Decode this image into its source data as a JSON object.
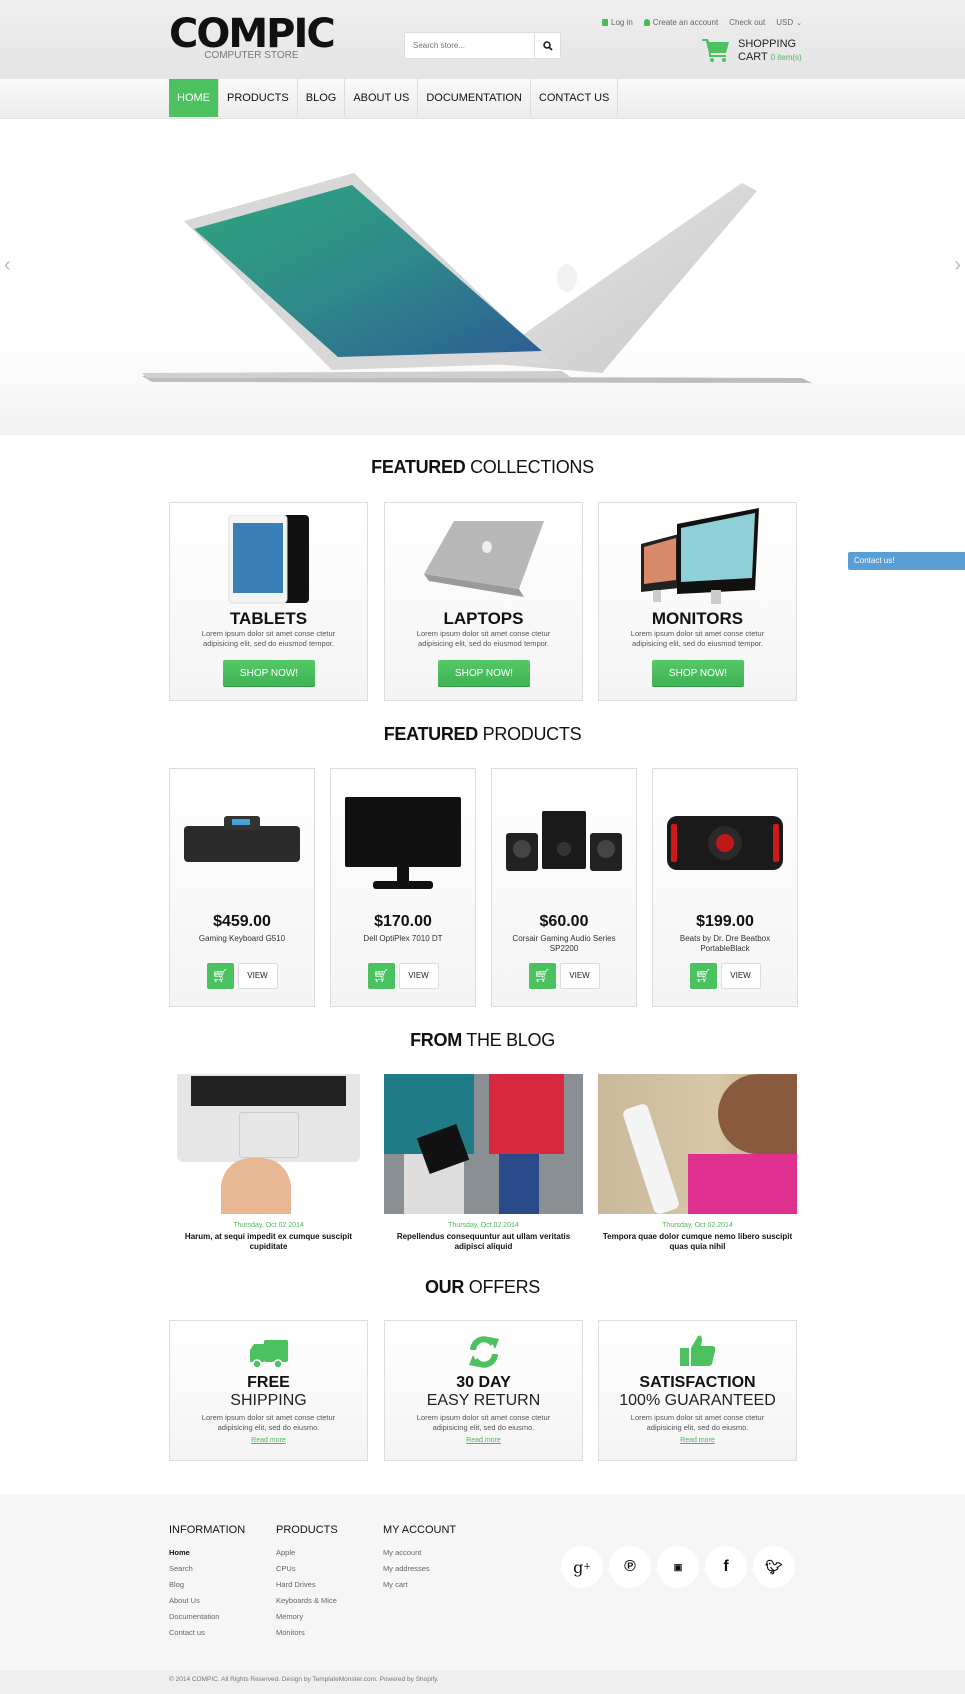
{
  "header": {
    "logo_name": "COMPIC",
    "logo_sub": "COMPUTER STORE",
    "search_placeholder": "Search store...",
    "links": {
      "login": "Log in",
      "create": "Create an account",
      "checkout": "Check out",
      "currency": "USD"
    },
    "cart": {
      "line1": "SHOPPING",
      "line2": "CART",
      "count": "0 item(s)"
    }
  },
  "nav": [
    "HOME",
    "PRODUCTS",
    "BLOG",
    "ABOUT US",
    "DOCUMENTATION",
    "CONTACT US"
  ],
  "hero": {
    "prev": "‹",
    "next": "›"
  },
  "contact_tab": "Contact us!",
  "collections": {
    "title_bold": "FEATURED",
    "title_light": "COLLECTIONS",
    "items": [
      {
        "title": "TABLETS",
        "desc1": "Lorem ipsum dolor sit amet conse ctetur",
        "desc2": "adipisicing elit, sed do eiusmod tempor.",
        "button": "SHOP NOW!"
      },
      {
        "title": "LAPTOPS",
        "desc1": "Lorem ipsum dolor sit amet conse ctetur",
        "desc2": "adipisicing elit, sed do eiusmod tempor.",
        "button": "SHOP NOW!"
      },
      {
        "title": "MONITORS",
        "desc1": "Lorem ipsum dolor sit amet conse ctetur",
        "desc2": "adipisicing elit, sed do eiusmod tempor.",
        "button": "SHOP NOW!"
      }
    ]
  },
  "products": {
    "title_bold": "FEATURED",
    "title_light": "PRODUCTS",
    "view_label": "VIEW",
    "items": [
      {
        "price": "$459.00",
        "name": "Gaming Keyboard G510"
      },
      {
        "price": "$170.00",
        "name": "Dell OptiPlex 7010 DT"
      },
      {
        "price": "$60.00",
        "name": "Corsair Gaming Audio Series SP2200"
      },
      {
        "price": "$199.00",
        "name": "Beats by Dr. Dre Beatbox PortableBlack"
      }
    ]
  },
  "blog": {
    "title_bold": "FROM",
    "title_light": "THE BLOG",
    "posts": [
      {
        "date": "Thursday, Oct 02 2014",
        "title": "Harum, at sequi impedit ex cumque suscipit cupiditate"
      },
      {
        "date": "Thursday, Oct 02 2014",
        "title": "Repellendus consequuntur aut ullam veritatis adipisci aliquid"
      },
      {
        "date": "Thursday, Oct 02 2014",
        "title": "Tempora quae dolor cumque nemo libero suscipit quas quia nihil"
      }
    ]
  },
  "offers": {
    "title_bold": "OUR",
    "title_light": "OFFERS",
    "items": [
      {
        "icon": "truck",
        "line1": "FREE",
        "line2": "SHIPPING",
        "desc1": "Lorem ipsum dolor sit amet conse ctetur",
        "desc2": "adipisicing elit, sed do eiusmo.",
        "link": "Read more"
      },
      {
        "icon": "refresh",
        "line1": "30 DAY",
        "line2": "EASY RETURN",
        "desc1": "Lorem ipsum dolor sit amet conse ctetur",
        "desc2": "adipisicing elit, sed do eiusmo.",
        "link": "Read more"
      },
      {
        "icon": "thumbs-up",
        "line1": "SATISFACTION",
        "line2": "100% GUARANTEED",
        "desc1": "Lorem ipsum dolor sit amet conse ctetur",
        "desc2": "adipisicing elit, sed do eiusmo.",
        "link": "Read more"
      }
    ]
  },
  "footer": {
    "information": {
      "title": "INFORMATION",
      "items": [
        "Home",
        "Search",
        "Blog",
        "About Us",
        "Documentation",
        "Contact us"
      ]
    },
    "products": {
      "title": "PRODUCTS",
      "items": [
        "Apple",
        "CPUs",
        "Hard Drives",
        "Keyboards & Mice",
        "Memory",
        "Monitors"
      ]
    },
    "account": {
      "title": "MY ACCOUNT",
      "items": [
        "My account",
        "My addresses",
        "My cart"
      ]
    },
    "social": [
      "google-plus",
      "pinterest",
      "youtube",
      "facebook",
      "twitter"
    ],
    "copyright": "© 2014 COMPIC. All Rights Reserved. Design by TemplateMonster.com. Powered by Shopify."
  },
  "colors": {
    "accent": "#4cc15f",
    "contact_tab": "#5a9ed6"
  }
}
